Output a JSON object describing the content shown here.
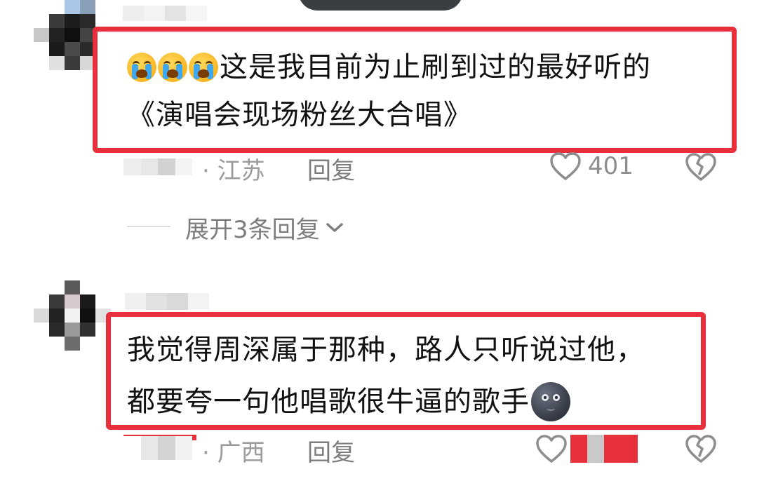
{
  "comments": [
    {
      "text_line1": "这是我目前为止刷到过的最好听的",
      "text_line2": "《演唱会现场粉丝大合唱》",
      "emoji_prefix": [
        "crying-face-icon",
        "crying-face-icon",
        "crying-face-icon"
      ],
      "location": "· 江苏",
      "reply_label": "回复",
      "like_count": "401"
    },
    {
      "text_line1": "我觉得周深属于那种，路人只听说过他，",
      "text_line2": "都要夸一句他唱歌很牛逼的歌手",
      "emoji_suffix": "new-moon-face-icon",
      "location": "· 广西",
      "reply_label": "回复"
    }
  ],
  "expand_replies": {
    "label": "展开3条回复"
  },
  "colors": {
    "highlight": "#e8303d",
    "meta_text": "#9b9b9b",
    "body_text": "#111111"
  }
}
